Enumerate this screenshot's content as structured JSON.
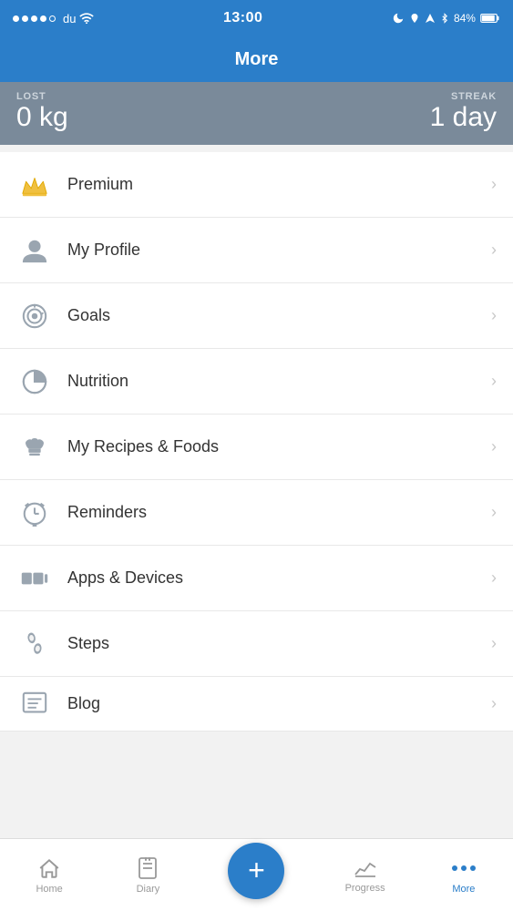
{
  "status_bar": {
    "carrier": "du",
    "time": "13:00",
    "battery": "84%"
  },
  "nav": {
    "title": "More"
  },
  "stats": {
    "lost_label": "LOST",
    "lost_value": "0 kg",
    "streak_label": "STREAK",
    "streak_value": "1 day"
  },
  "menu": {
    "items": [
      {
        "id": "premium",
        "label": "Premium",
        "icon": "crown"
      },
      {
        "id": "my-profile",
        "label": "My Profile",
        "icon": "person"
      },
      {
        "id": "goals",
        "label": "Goals",
        "icon": "target"
      },
      {
        "id": "nutrition",
        "label": "Nutrition",
        "icon": "pie-chart"
      },
      {
        "id": "my-recipes-foods",
        "label": "My Recipes & Foods",
        "icon": "chef-hat"
      },
      {
        "id": "reminders",
        "label": "Reminders",
        "icon": "alarm"
      },
      {
        "id": "apps-devices",
        "label": "Apps & Devices",
        "icon": "devices"
      },
      {
        "id": "steps",
        "label": "Steps",
        "icon": "footsteps"
      },
      {
        "id": "blog",
        "label": "Blog",
        "icon": "blog"
      }
    ]
  },
  "tabs": [
    {
      "id": "home",
      "label": "Home",
      "active": false
    },
    {
      "id": "diary",
      "label": "Diary",
      "active": false
    },
    {
      "id": "add",
      "label": "",
      "active": false
    },
    {
      "id": "progress",
      "label": "Progress",
      "active": false
    },
    {
      "id": "more",
      "label": "More",
      "active": true
    }
  ]
}
